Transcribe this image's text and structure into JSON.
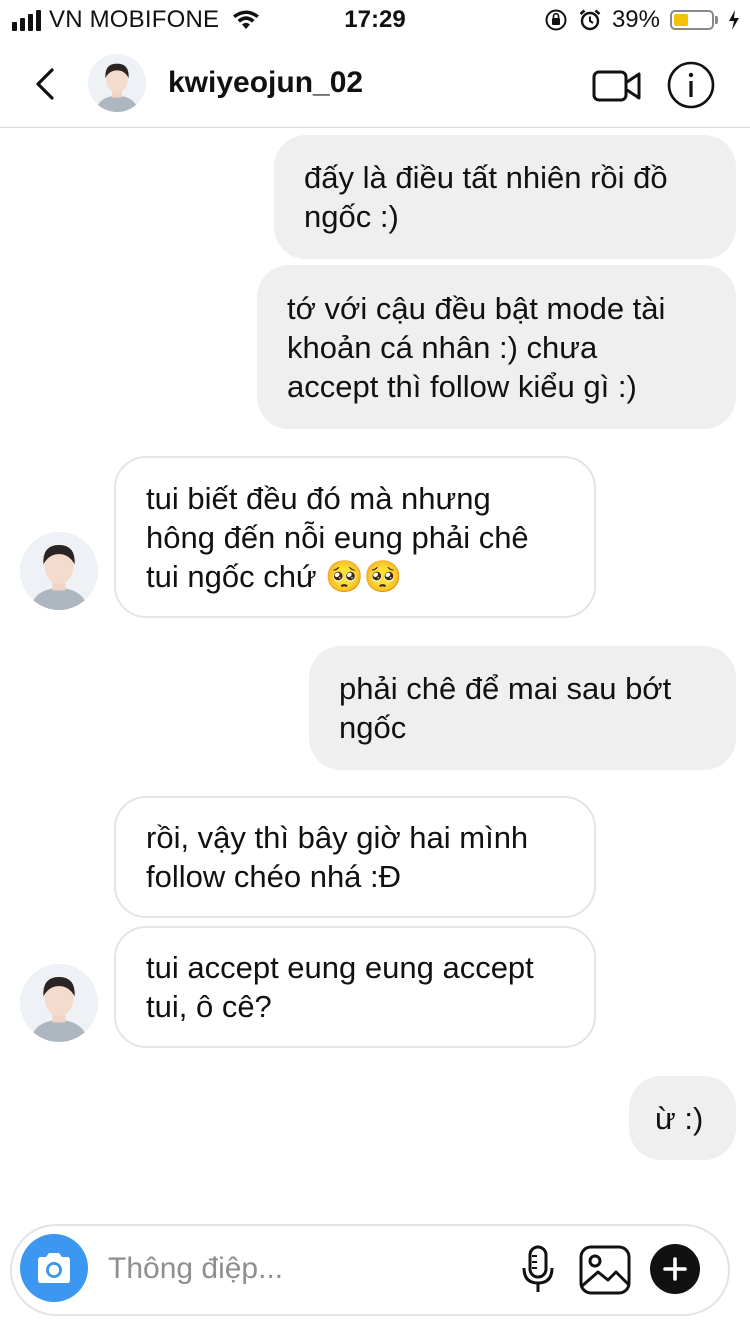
{
  "status_bar": {
    "carrier": "VN MOBIFONE",
    "time": "17:29",
    "battery": "39%",
    "battery_level": 0.39,
    "icons": [
      "signal-icon",
      "wifi-icon",
      "orientation-lock-icon",
      "alarm-icon",
      "battery-icon",
      "charging-icon"
    ]
  },
  "header": {
    "username": "kwiyeojun_02",
    "icons": [
      "back-arrow-icon",
      "video-call-icon",
      "info-icon"
    ]
  },
  "messages": [
    {
      "direction": "outgoing",
      "text": "đấy là điều tất nhiên rồi đồ\nngốc :)"
    },
    {
      "direction": "outgoing",
      "text": "tớ với cậu đều bật mode tài\nkhoản cá nhân :) chưa\naccept thì follow kiểu gì :)"
    },
    {
      "direction": "incoming",
      "text": "tui biết đều đó mà nhưng\nhông đến nỗi eung phải chê\ntui ngốc chứ 🥺🥺"
    },
    {
      "direction": "outgoing",
      "text": "phải chê để mai sau bớt\nngốc"
    },
    {
      "direction": "incoming",
      "text": "rồi, vậy thì bây giờ hai mình\nfollow chéo nhá :Đ"
    },
    {
      "direction": "incoming",
      "text": "tui accept eung eung accept\ntui, ô cê?"
    },
    {
      "direction": "outgoing",
      "text": "ừ :)"
    }
  ],
  "composer": {
    "placeholder": "Thông điệp...",
    "value": "",
    "icons": [
      "camera-icon",
      "microphone-icon",
      "gallery-icon",
      "plus-icon"
    ]
  },
  "colors": {
    "outgoing_bubble": "#efefef",
    "incoming_border": "#e4e4e4",
    "camera_button": "#3b97f0",
    "battery_fill": "#f3c10a",
    "placeholder": "#8e8e8e"
  }
}
